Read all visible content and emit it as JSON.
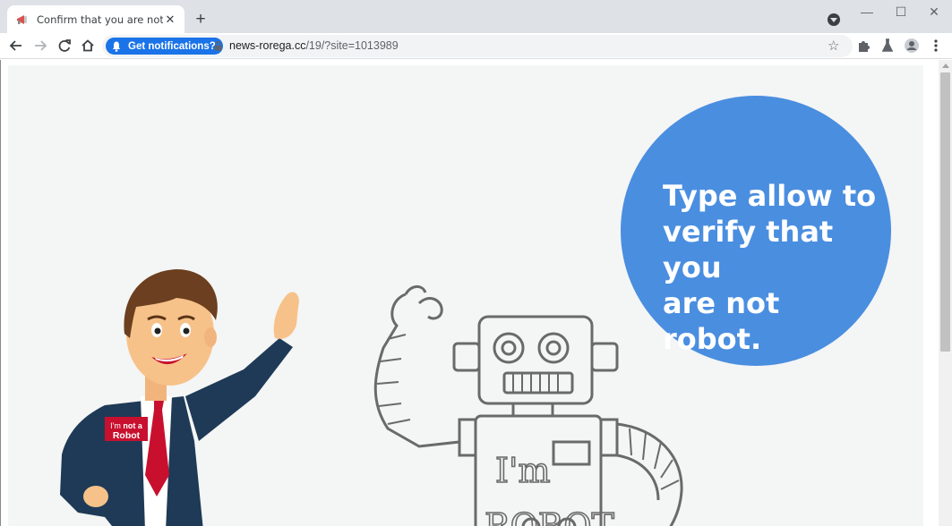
{
  "browser": {
    "tab": {
      "title": "Confirm that you are not a robot",
      "close": "✕"
    },
    "new_tab": "+",
    "window_controls": {
      "minimize": "—",
      "maximize": "☐",
      "close": "✕"
    },
    "notification_chip": "Get notifications?",
    "url": {
      "host": "news-rorega.cc",
      "path": "/19/?site=1013989"
    },
    "accent_color": "#1a73e8"
  },
  "page": {
    "message_lines": [
      "Type allow to",
      "verify that you",
      "are not robot."
    ],
    "badge": {
      "line1_prefix": "I'm",
      "line1_bold": "not a",
      "line2": "Robot"
    },
    "robot_text": {
      "top": "I'm",
      "bottom": "ROBOT"
    },
    "bubble_color": "#4a8ee0"
  }
}
